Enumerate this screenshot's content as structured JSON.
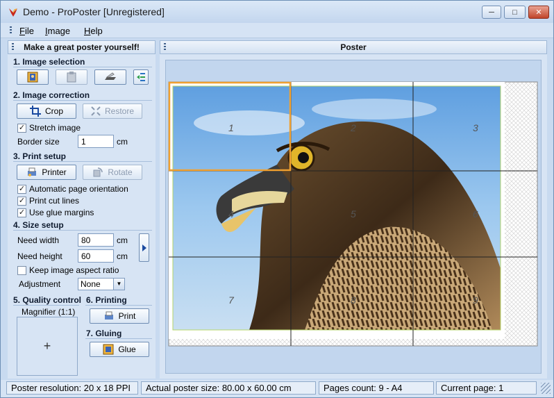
{
  "window": {
    "title": "Demo - ProPoster [Unregistered]"
  },
  "menu": [
    {
      "prefix": "F",
      "rest": "ile"
    },
    {
      "prefix": "I",
      "rest": "mage"
    },
    {
      "prefix": "H",
      "rest": "elp"
    }
  ],
  "left_panel": {
    "title": "Make a great poster yourself!",
    "sections": {
      "image_selection": "1. Image selection",
      "image_correction": "2. Image correction",
      "print_setup": "3. Print setup",
      "size_setup": "4. Size setup",
      "quality_control": "5. Quality control",
      "printing": "6. Printing",
      "gluing": "7. Gluing"
    },
    "crop_label": "Crop",
    "restore_label": "Restore",
    "stretch_label": "Stretch image",
    "stretch_checked": true,
    "border_label": "Border size",
    "border_value": "1",
    "border_unit": "cm",
    "printer_label": "Printer",
    "rotate_label": "Rotate",
    "auto_orient_label": "Automatic page orientation",
    "auto_orient_checked": true,
    "cut_lines_label": "Print cut lines",
    "cut_lines_checked": true,
    "glue_margins_label": "Use glue margins",
    "glue_margins_checked": true,
    "width_label": "Need width",
    "width_value": "80",
    "width_unit": "cm",
    "height_label": "Need height",
    "height_value": "60",
    "height_unit": "cm",
    "aspect_label": "Keep image aspect ratio",
    "aspect_checked": false,
    "adjustment_label": "Adjustment",
    "adjustment_value": "None",
    "magnifier_label": "Magnifier (1:1)",
    "print_label": "Print",
    "glue_label": "Glue"
  },
  "poster": {
    "title": "Poster",
    "pages": [
      "1",
      "2",
      "3",
      "4",
      "5",
      "6",
      "7",
      "8",
      "9"
    ],
    "current_page": 1
  },
  "status": {
    "resolution": "Poster resolution: 20 x 18 PPI",
    "actual_size": "Actual poster size: 80.00 x 60.00 cm",
    "pages_count": "Pages count: 9 - A4",
    "current_page": "Current page: 1"
  },
  "colors": {
    "accent": "#f0a030",
    "sky": "#8fc0ea"
  }
}
